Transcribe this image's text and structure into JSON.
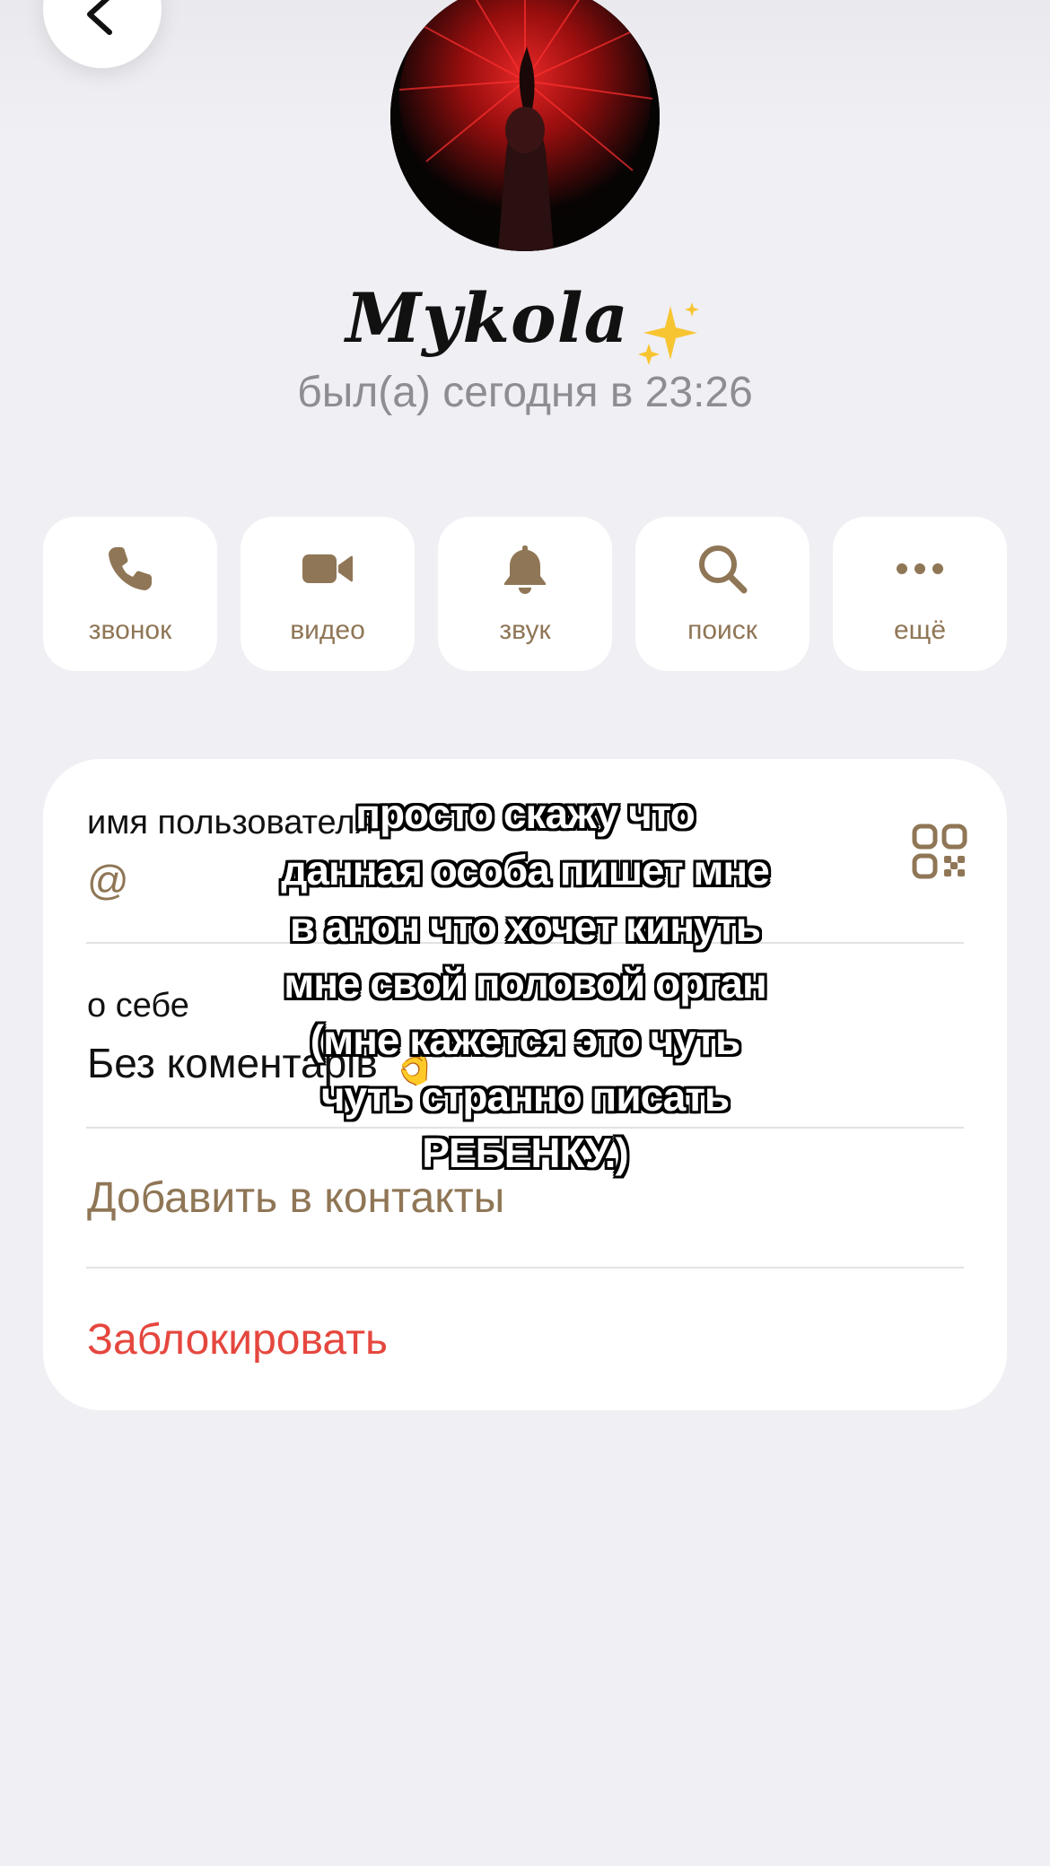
{
  "profile": {
    "name": "Mykola",
    "name_emoji": "✨",
    "status": "был(а) сегодня в 23:26"
  },
  "actions": [
    {
      "label": "звонок",
      "icon": "phone-icon"
    },
    {
      "label": "видео",
      "icon": "video-camera-icon"
    },
    {
      "label": "звук",
      "icon": "bell-icon"
    },
    {
      "label": "поиск",
      "icon": "search-icon"
    },
    {
      "label": "ещё",
      "icon": "more-dots-icon"
    }
  ],
  "info": {
    "username_label": "имя пользователя",
    "username_value": "@",
    "bio_label": "о себе",
    "bio_value": "Без коментарів 👌",
    "add_contact": "Добавить в контакты",
    "block": "Заблокировать"
  },
  "overlay_caption": {
    "lines": [
      "просто скажу что",
      "данная особа пишет мне",
      "в анон что хочет кинуть",
      "мне свой половой орган",
      "(мне кажется это чуть",
      "чуть странно писать",
      "РЕБЕНКУ.)"
    ]
  },
  "colors": {
    "background": "#efeff4",
    "accent": "#8f7656",
    "destructive": "#e5473e",
    "card": "#ffffff"
  }
}
